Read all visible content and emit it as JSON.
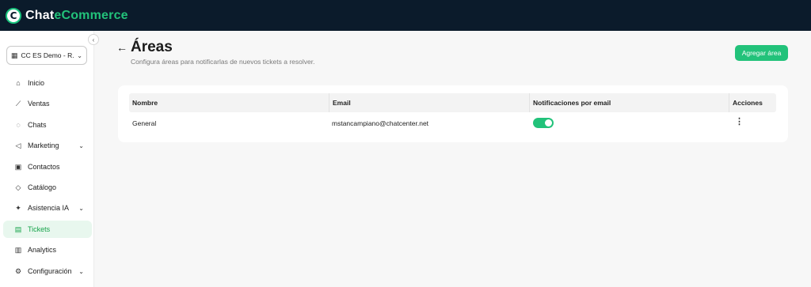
{
  "brand": {
    "part1": "Chat",
    "part2": "eCommerce",
    "logo_letter": "C"
  },
  "sidebar": {
    "collapse_icon": "chevron-left-icon",
    "store_select": {
      "value": "CC ES Demo - R...",
      "icon": "store-icon"
    },
    "items": [
      {
        "label": "Inicio",
        "icon": "home-icon",
        "glyph": "⌂",
        "has_chevron": false
      },
      {
        "label": "Ventas",
        "icon": "chart-line-icon",
        "glyph": "⟋",
        "has_chevron": false
      },
      {
        "label": "Chats",
        "icon": "chat-bubble-icon",
        "glyph": "◌",
        "has_chevron": false
      },
      {
        "label": "Marketing",
        "icon": "megaphone-icon",
        "glyph": "◁",
        "has_chevron": true
      },
      {
        "label": "Contactos",
        "icon": "contact-card-icon",
        "glyph": "▣",
        "has_chevron": false
      },
      {
        "label": "Catálogo",
        "icon": "tag-icon",
        "glyph": "◇",
        "has_chevron": false
      },
      {
        "label": "Asistencia IA",
        "icon": "sparkle-icon",
        "glyph": "✦",
        "has_chevron": true
      },
      {
        "label": "Tickets",
        "icon": "ticket-icon",
        "glyph": "▤",
        "has_chevron": false,
        "active": true
      },
      {
        "label": "Analytics",
        "icon": "bar-chart-icon",
        "glyph": "▥",
        "has_chevron": false
      },
      {
        "label": "Configuración",
        "icon": "gear-icon",
        "glyph": "⚙",
        "has_chevron": true
      }
    ]
  },
  "header": {
    "title": "Áreas",
    "subtitle": "Configura áreas para notificarlas de nuevos tickets a resolver.",
    "add_button_label": "Agregar área"
  },
  "table": {
    "columns": [
      "Nombre",
      "Email",
      "Notificaciones por email",
      "Acciones"
    ],
    "rows": [
      {
        "nombre": "General",
        "email": "mstancampiano@chatcenter.net",
        "notificaciones": true,
        "acciones_icon": "more-vertical-icon"
      }
    ]
  },
  "colors": {
    "accent": "#22c27a",
    "topbar": "#0b1b2b",
    "active_bg": "#e8f7ee"
  }
}
